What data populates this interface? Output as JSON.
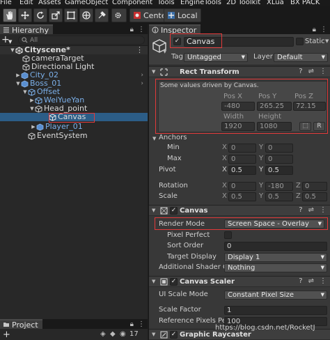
{
  "menubar": {
    "items": [
      "File",
      "Edit",
      "Assets",
      "GameObject",
      "Component",
      "Tools",
      "EngineTools",
      "2D Toolkit",
      "XLua",
      "BX PACK"
    ]
  },
  "toolbar": {
    "center_label": "Center",
    "local_label": "Local"
  },
  "hierarchy": {
    "tab_label": "Hierarchy",
    "search_placeholder": "All",
    "rows": [
      {
        "label": "Cityscene*"
      },
      {
        "label": "cameraTarget"
      },
      {
        "label": "Directional Light"
      },
      {
        "label": "City_02"
      },
      {
        "label": "Boss_01"
      },
      {
        "label": "Offset"
      },
      {
        "label": "WeiYueYan"
      },
      {
        "label": "Head_point"
      },
      {
        "label": "Canvas"
      },
      {
        "label": "Player_01"
      },
      {
        "label": "EventSystem"
      }
    ]
  },
  "project": {
    "tab_label": "Project",
    "count": "17"
  },
  "inspector": {
    "tab_label": "Inspector",
    "object_name": "Canvas",
    "static_label": "Static",
    "tag_label": "Tag",
    "tag_value": "Untagged",
    "layer_label": "Layer",
    "layer_value": "Default",
    "rect_transform": {
      "title": "Rect Transform",
      "driven_note": "Some values driven by Canvas.",
      "pos_x_label": "Pos X",
      "pos_y_label": "Pos Y",
      "pos_z_label": "Pos Z",
      "pos_x": "-480",
      "pos_y": "265.25",
      "pos_z": "72.15",
      "width_label": "Width",
      "height_label": "Height",
      "width": "1920",
      "height": "1080",
      "r_button": "R",
      "anchors_label": "Anchors",
      "min_label": "Min",
      "max_label": "Max",
      "min_x": "0",
      "min_y": "0",
      "max_x": "0",
      "max_y": "0",
      "pivot_label": "Pivot",
      "pivot_x": "0.5",
      "pivot_y": "0.5",
      "rotation_label": "Rotation",
      "rot_x": "0",
      "rot_y": "-180",
      "rot_z": "0",
      "scale_label": "Scale",
      "scale_x": "0.5",
      "scale_y": "0.5",
      "scale_z": "0.5",
      "axis_x": "X",
      "axis_y": "Y",
      "axis_z": "Z"
    },
    "canvas": {
      "title": "Canvas",
      "render_mode_label": "Render Mode",
      "render_mode_value": "Screen Space - Overlay",
      "pixel_perfect_label": "Pixel Perfect",
      "sort_order_label": "Sort Order",
      "sort_order_value": "0",
      "target_display_label": "Target Display",
      "target_display_value": "Display 1",
      "additional_label": "Additional Shader Ch",
      "additional_value": "Nothing"
    },
    "canvas_scaler": {
      "title": "Canvas Scaler",
      "ui_scale_mode_label": "UI Scale Mode",
      "ui_scale_mode_value": "Constant Pixel Size",
      "scale_factor_label": "Scale Factor",
      "scale_factor_value": "1",
      "ref_ppu_label": "Reference Pixels Per",
      "ref_ppu_value": "100"
    },
    "graphic_raycaster": {
      "title": "Graphic Raycaster"
    }
  },
  "watermark": "https://blog.csdn.net/RocketJ"
}
